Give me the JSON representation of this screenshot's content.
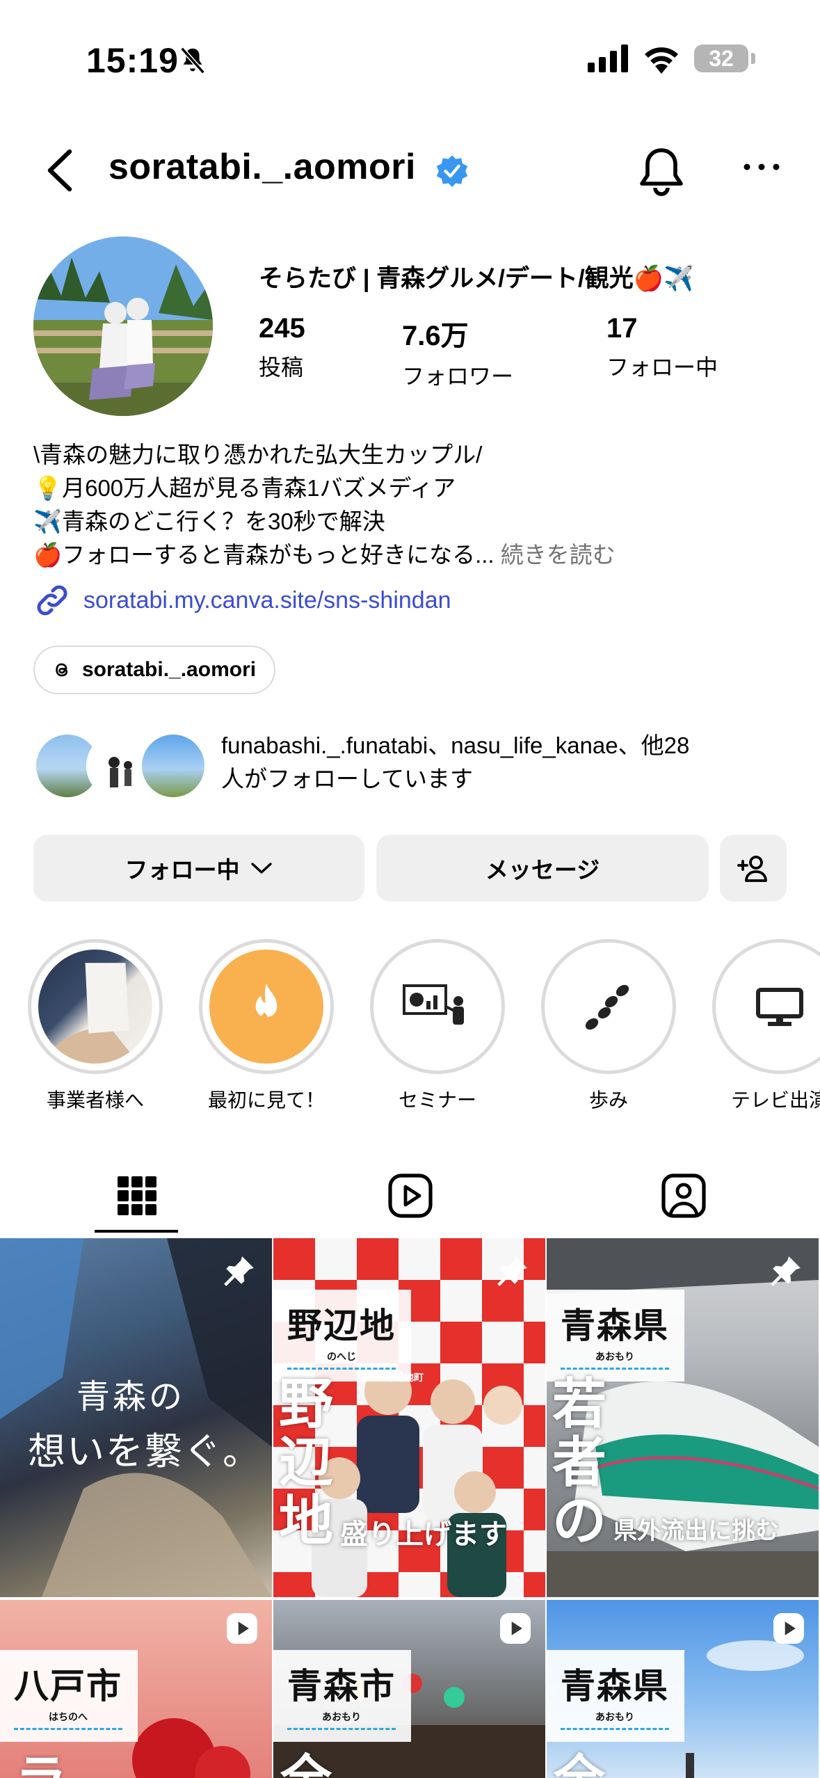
{
  "status_bar": {
    "time": "15:19",
    "battery": "32"
  },
  "header": {
    "username": "soratabi._.aomori"
  },
  "profile": {
    "display_name": "そらたび | 青森グルメ/デート/観光🍎✈️",
    "stats": [
      {
        "value": "245",
        "label": "投稿"
      },
      {
        "value": "7.6万",
        "label": "フォロワー"
      },
      {
        "value": "17",
        "label": "フォロー中"
      }
    ],
    "bio": [
      "\\青森の魅力に取り憑かれた弘大生カップル/",
      "💡月600万人超が見る青森1バズメディア",
      "✈️青森のどこ行く？を30秒で解決",
      "🍎フォローすると青森がもっと好きになる..."
    ],
    "bio_more": "続きを読む",
    "link": "soratabi.my.canva.site/sns-shindan",
    "threads_handle": "soratabi._.aomori",
    "mutual_line1": "funabashi._.funatabi、nasu_life_kanae、他28",
    "mutual_line2": "人がフォローしています"
  },
  "buttons": {
    "following": "フォロー中",
    "message": "メッセージ"
  },
  "highlights": [
    {
      "label": "事業者様へ"
    },
    {
      "label": "最初に見て！"
    },
    {
      "label": "セミナー"
    },
    {
      "label": "歩み"
    },
    {
      "label": "テレビ出演"
    }
  ],
  "posts": [
    {
      "caption_line1": "青森の",
      "caption_line2": "想いを繋ぐ。"
    },
    {
      "place": "野辺地",
      "kana": "のへじ",
      "headline": "野辺地",
      "tail": "盛り上げます",
      "booth": "野辺地町"
    },
    {
      "place": "青森県",
      "kana": "あおもり",
      "headline": "若者の",
      "tail": "県外流出に挑む"
    },
    {
      "place": "八戸市",
      "kana": "はちのへ",
      "headline": "ラ"
    },
    {
      "place": "青森市",
      "kana": "あおもり",
      "headline": "全"
    },
    {
      "place": "青森県",
      "kana": "あおもり",
      "headline": "全"
    }
  ],
  "colors": {
    "accent_blue": "#3897f0",
    "link": "#3b4cd0",
    "button_bg": "#efefef",
    "highlight_orange": "#f9b04f"
  }
}
